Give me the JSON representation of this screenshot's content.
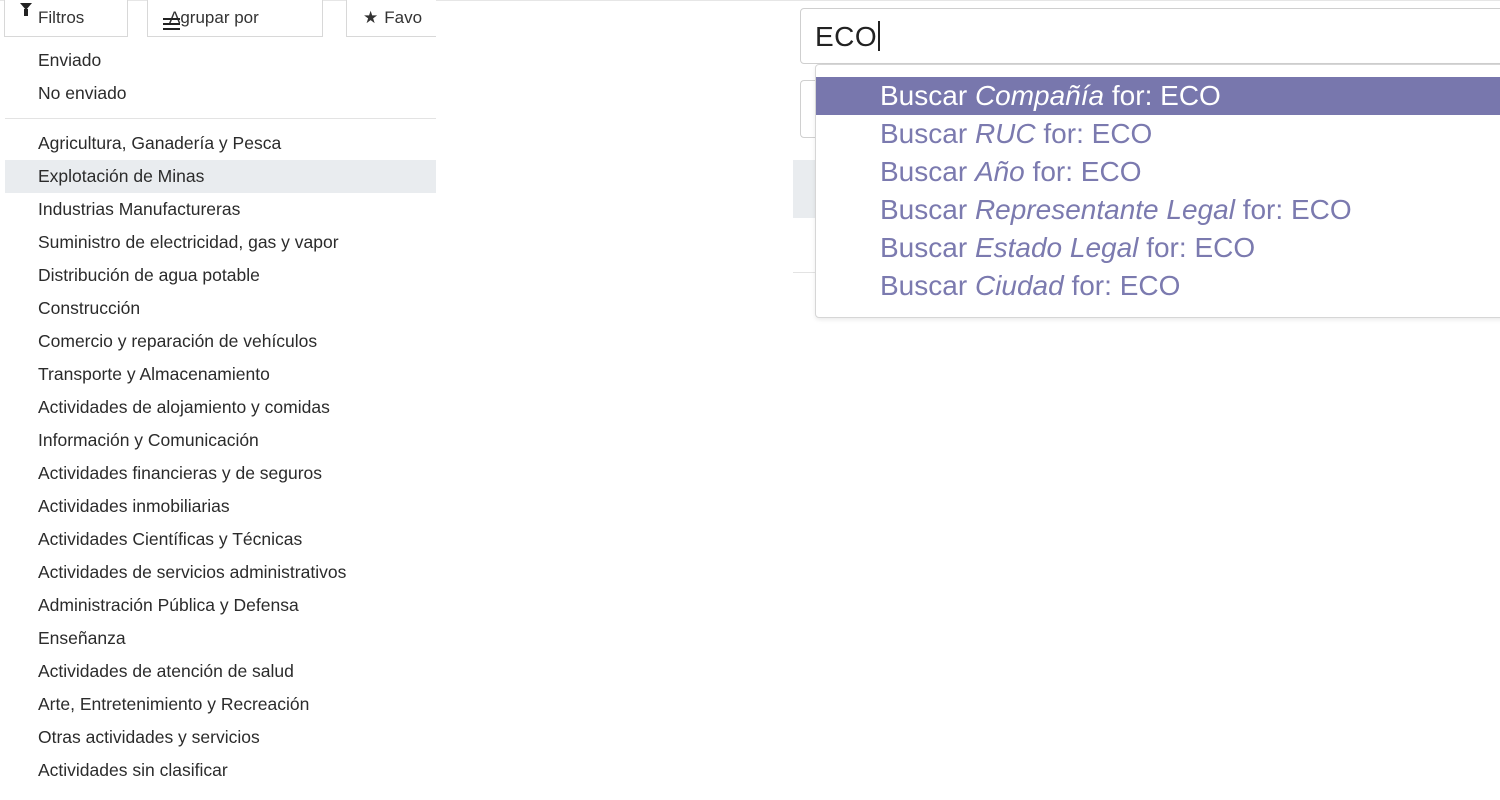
{
  "toolbar": {
    "filters_label": "Filtros",
    "group_label": "Agrupar por",
    "favorites_label": "Favo"
  },
  "filters": {
    "status": [
      "Enviado",
      "No enviado"
    ],
    "sectors": [
      "Agricultura, Ganadería y Pesca",
      "Explotación de Minas",
      "Industrias Manufactureras",
      "Suministro de electricidad, gas y vapor",
      "Distribución de agua potable",
      "Construcción",
      "Comercio y reparación de vehículos",
      "Transporte y Almacenamiento",
      "Actividades de alojamiento y comidas",
      "Información y Comunicación",
      "Actividades financieras y de seguros",
      "Actividades inmobiliarias",
      "Actividades Científicas y Técnicas",
      "Actividades de servicios administrativos",
      "Administración Pública y Defensa",
      "Enseñanza",
      "Actividades de atención de salud",
      "Arte, Entretenimiento y Recreación",
      "Otras actividades y servicios",
      "Actividades sin clasificar"
    ],
    "highlighted": "Explotación de Minas"
  },
  "search": {
    "value": "ECO"
  },
  "autocomplete": {
    "prefix": "Buscar",
    "connector": "for:",
    "items": [
      {
        "field": "Compañía",
        "query": "ECO"
      },
      {
        "field": "RUC",
        "query": "ECO"
      },
      {
        "field": "Año",
        "query": "ECO"
      },
      {
        "field": "Representante Legal",
        "query": "ECO"
      },
      {
        "field": "Estado Legal",
        "query": "ECO"
      },
      {
        "field": "Ciudad",
        "query": "ECO"
      }
    ]
  },
  "colors": {
    "autocomplete_active_bg": "#7877ad",
    "autocomplete_text": "#7b7aaf",
    "menu_highlight_bg": "#e9ecef"
  },
  "icons": {
    "filters": "filter-icon",
    "group": "bars-icon",
    "favorites": "star-icon"
  }
}
